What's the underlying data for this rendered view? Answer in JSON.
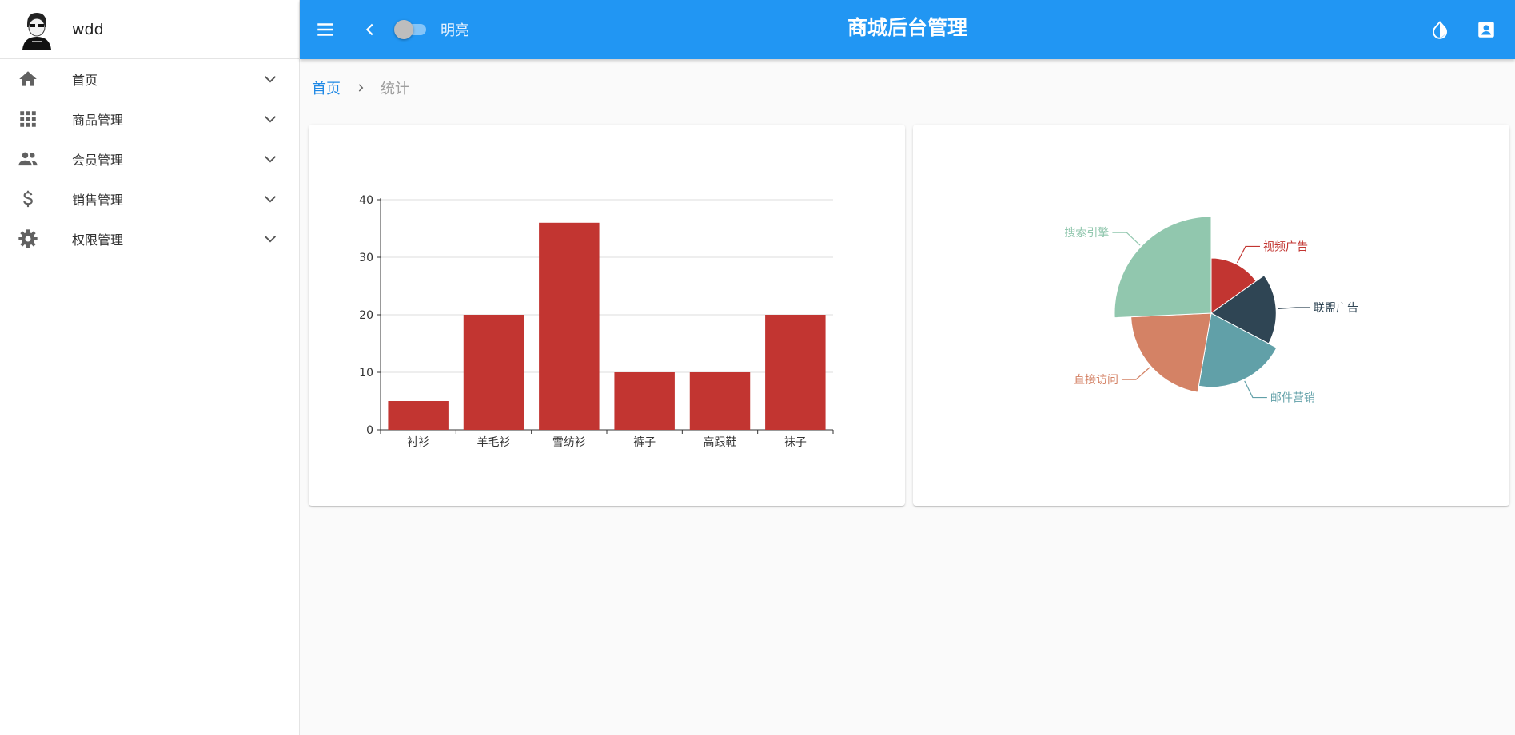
{
  "user": {
    "name": "wdd"
  },
  "sidebar": {
    "items": [
      {
        "label": "首页",
        "icon": "home-icon"
      },
      {
        "label": "商品管理",
        "icon": "apps-grid-icon"
      },
      {
        "label": "会员管理",
        "icon": "people-icon"
      },
      {
        "label": "销售管理",
        "icon": "dollar-icon"
      },
      {
        "label": "权限管理",
        "icon": "gear-icon"
      }
    ]
  },
  "header": {
    "title": "商城后台管理",
    "theme_toggle_label": "明亮",
    "theme_toggle_on": false,
    "accent_color": "#2196f3"
  },
  "breadcrumb": {
    "home": "首页",
    "current": "统计"
  },
  "chart_data": [
    {
      "type": "bar",
      "categories": [
        "衬衫",
        "羊毛衫",
        "雪纺衫",
        "裤子",
        "高跟鞋",
        "袜子"
      ],
      "values": [
        5,
        20,
        36,
        10,
        10,
        20
      ],
      "ylim": [
        0,
        40
      ],
      "yticks": [
        0,
        10,
        20,
        30,
        40
      ],
      "color": "#c23531",
      "grid": true
    },
    {
      "type": "pie",
      "rose": "radius",
      "slices": [
        {
          "name": "视频广告",
          "value": 235,
          "color": "#c23531"
        },
        {
          "name": "联盟广告",
          "value": 274,
          "color": "#2f4554"
        },
        {
          "name": "邮件营销",
          "value": 310,
          "color": "#61a0a8"
        },
        {
          "name": "直接访问",
          "value": 335,
          "color": "#d48265"
        },
        {
          "name": "搜索引擎",
          "value": 400,
          "color": "#91c7ae"
        }
      ]
    }
  ]
}
